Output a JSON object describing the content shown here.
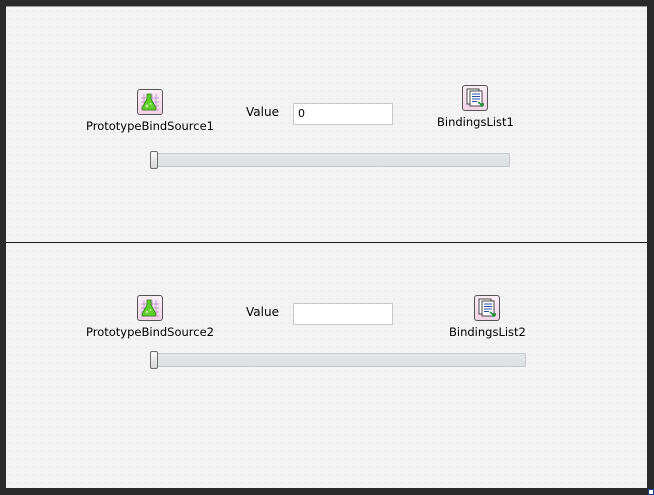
{
  "top_panel": {
    "bind_source": {
      "caption": "PrototypeBindSource1",
      "icon": "flask-grid-icon"
    },
    "value_label": "Value",
    "value_input": "0",
    "bindings_list": {
      "caption": "BindingsList1",
      "icon": "document-list-icon"
    },
    "slider": {
      "value_fraction": 0.0
    }
  },
  "bottom_panel": {
    "bind_source": {
      "caption": "PrototypeBindSource2",
      "icon": "flask-grid-icon"
    },
    "value_label": "Value",
    "value_input": "",
    "bindings_list": {
      "caption": "BindingsList2",
      "icon": "document-list-icon"
    },
    "slider": {
      "value_fraction": 0.0
    }
  },
  "colors": {
    "form_background": "#f3f3f3",
    "splitter": "#1a1a1a",
    "icon_background": "#f3d3e6",
    "flask_green": "#5fcf2a"
  }
}
